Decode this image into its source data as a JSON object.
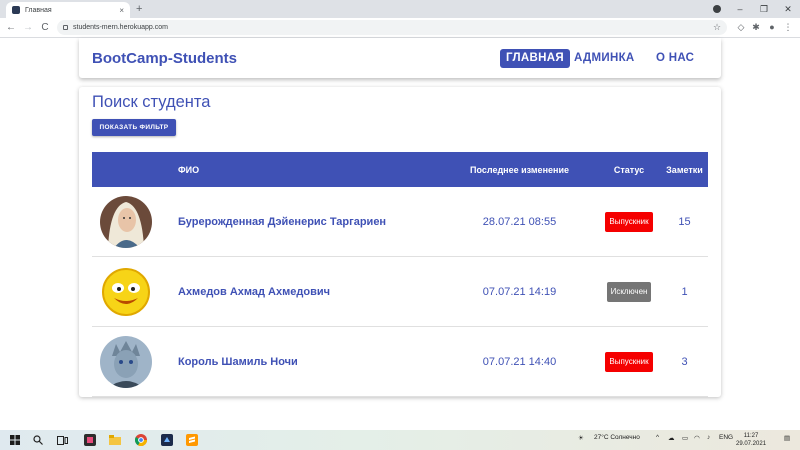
{
  "browser": {
    "tab_title": "Главная",
    "tab_close": "×",
    "new_tab": "+",
    "url": "students-mern.herokuapp.com",
    "window_controls": [
      "–",
      "❐",
      "✕"
    ],
    "nav": [
      "←",
      "→",
      "C"
    ]
  },
  "app": {
    "brand": "BootCamp-Students",
    "nav": [
      {
        "label": "ГЛАВНАЯ",
        "active": true
      },
      {
        "label": "АДМИНКА",
        "active": false
      },
      {
        "label": "О НАС",
        "active": false
      }
    ]
  },
  "main": {
    "title": "Поиск студента",
    "filter_button": "ПОКАЗАТЬ ФИЛЬТР",
    "table": {
      "headers": {
        "name": "ФИО",
        "date": "Последнее изменение",
        "status": "Статус",
        "notes": "Заметки"
      },
      "rows": [
        {
          "name": "Бурерожденная Дэйенерис Таргариен",
          "date": "28.07.21 08:55",
          "status": "Выпускник",
          "status_color": "#f50000",
          "notes": "15"
        },
        {
          "name": "Ахмедов Ахмад Ахмедович",
          "date": "07.07.21 14:19",
          "status": "Исключен",
          "status_color": "#757575",
          "notes": "1"
        },
        {
          "name": "Король Шамиль Ночи",
          "date": "07.07.21 14:40",
          "status": "Выпускник",
          "status_color": "#f50000",
          "notes": "3"
        }
      ]
    }
  },
  "colors": {
    "primary": "#3f51b5",
    "graduate": "#f50000",
    "expelled": "#757575"
  },
  "taskbar": {
    "weather": "27°C  Солнечно",
    "lang": "ENG",
    "time": "11:27",
    "date": "29.07.2021"
  }
}
